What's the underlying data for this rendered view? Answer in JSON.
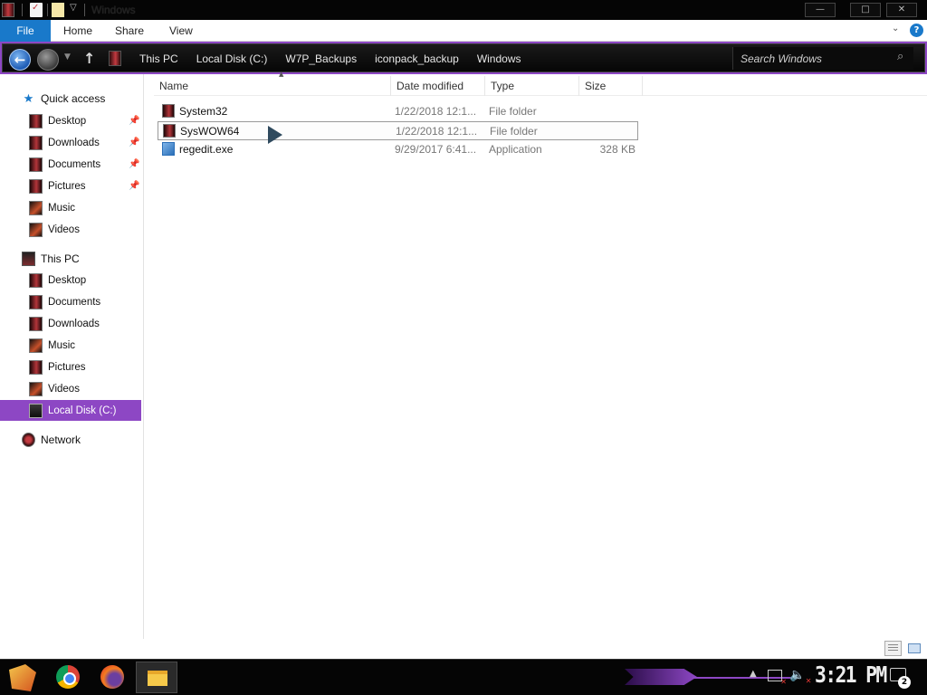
{
  "window": {
    "title": "Windows",
    "controls": {
      "minimize": "—",
      "maximize": "□",
      "close": "✕"
    }
  },
  "ribbon": {
    "tabs": [
      "File",
      "Home",
      "Share",
      "View"
    ],
    "expand_glyph": "⌄",
    "help_glyph": "?"
  },
  "address": {
    "breadcrumb": [
      "This PC",
      "Local Disk (C:)",
      "W7P_Backups",
      "iconpack_backup",
      "Windows"
    ],
    "search_placeholder": "Search Windows"
  },
  "nav": {
    "quick_access": {
      "label": "Quick access",
      "items": [
        {
          "label": "Desktop",
          "icon": "desktop-icon",
          "pinned": true
        },
        {
          "label": "Downloads",
          "icon": "downloads-icon",
          "pinned": true
        },
        {
          "label": "Documents",
          "icon": "documents-icon",
          "pinned": true
        },
        {
          "label": "Pictures",
          "icon": "pictures-icon",
          "pinned": true
        },
        {
          "label": "Music",
          "icon": "music-icon",
          "pinned": false
        },
        {
          "label": "Videos",
          "icon": "videos-icon",
          "pinned": false
        }
      ]
    },
    "this_pc": {
      "label": "This PC",
      "items": [
        {
          "label": "Desktop",
          "icon": "desktop-icon"
        },
        {
          "label": "Documents",
          "icon": "documents-icon"
        },
        {
          "label": "Downloads",
          "icon": "downloads-icon"
        },
        {
          "label": "Music",
          "icon": "music-icon"
        },
        {
          "label": "Pictures",
          "icon": "pictures-icon"
        },
        {
          "label": "Videos",
          "icon": "videos-icon"
        },
        {
          "label": "Local Disk (C:)",
          "icon": "drive-icon",
          "selected": true
        }
      ]
    },
    "network": {
      "label": "Network",
      "icon": "network-icon"
    }
  },
  "files": {
    "columns": [
      "Name",
      "Date modified",
      "Type",
      "Size"
    ],
    "sort_column": "Name",
    "rows": [
      {
        "name": "System32",
        "date": "1/22/2018 12:1...",
        "type": "File folder",
        "size": "",
        "icon": "folder-icon",
        "selected": false
      },
      {
        "name": "SysWOW64",
        "date": "1/22/2018 12:1...",
        "type": "File folder",
        "size": "",
        "icon": "folder-icon",
        "selected": true
      },
      {
        "name": "regedit.exe",
        "date": "9/29/2017 6:41...",
        "type": "Application",
        "size": "328 KB",
        "icon": "application-icon",
        "selected": false
      }
    ]
  },
  "taskbar": {
    "pinned": [
      "start-icon",
      "chrome-icon",
      "firefox-icon",
      "file-explorer-icon"
    ],
    "clock": "3:21 PM",
    "notification_count": "2"
  },
  "colors": {
    "accent": "#8d47c4",
    "file_tab": "#1979ca",
    "titlebar": "#050505"
  }
}
